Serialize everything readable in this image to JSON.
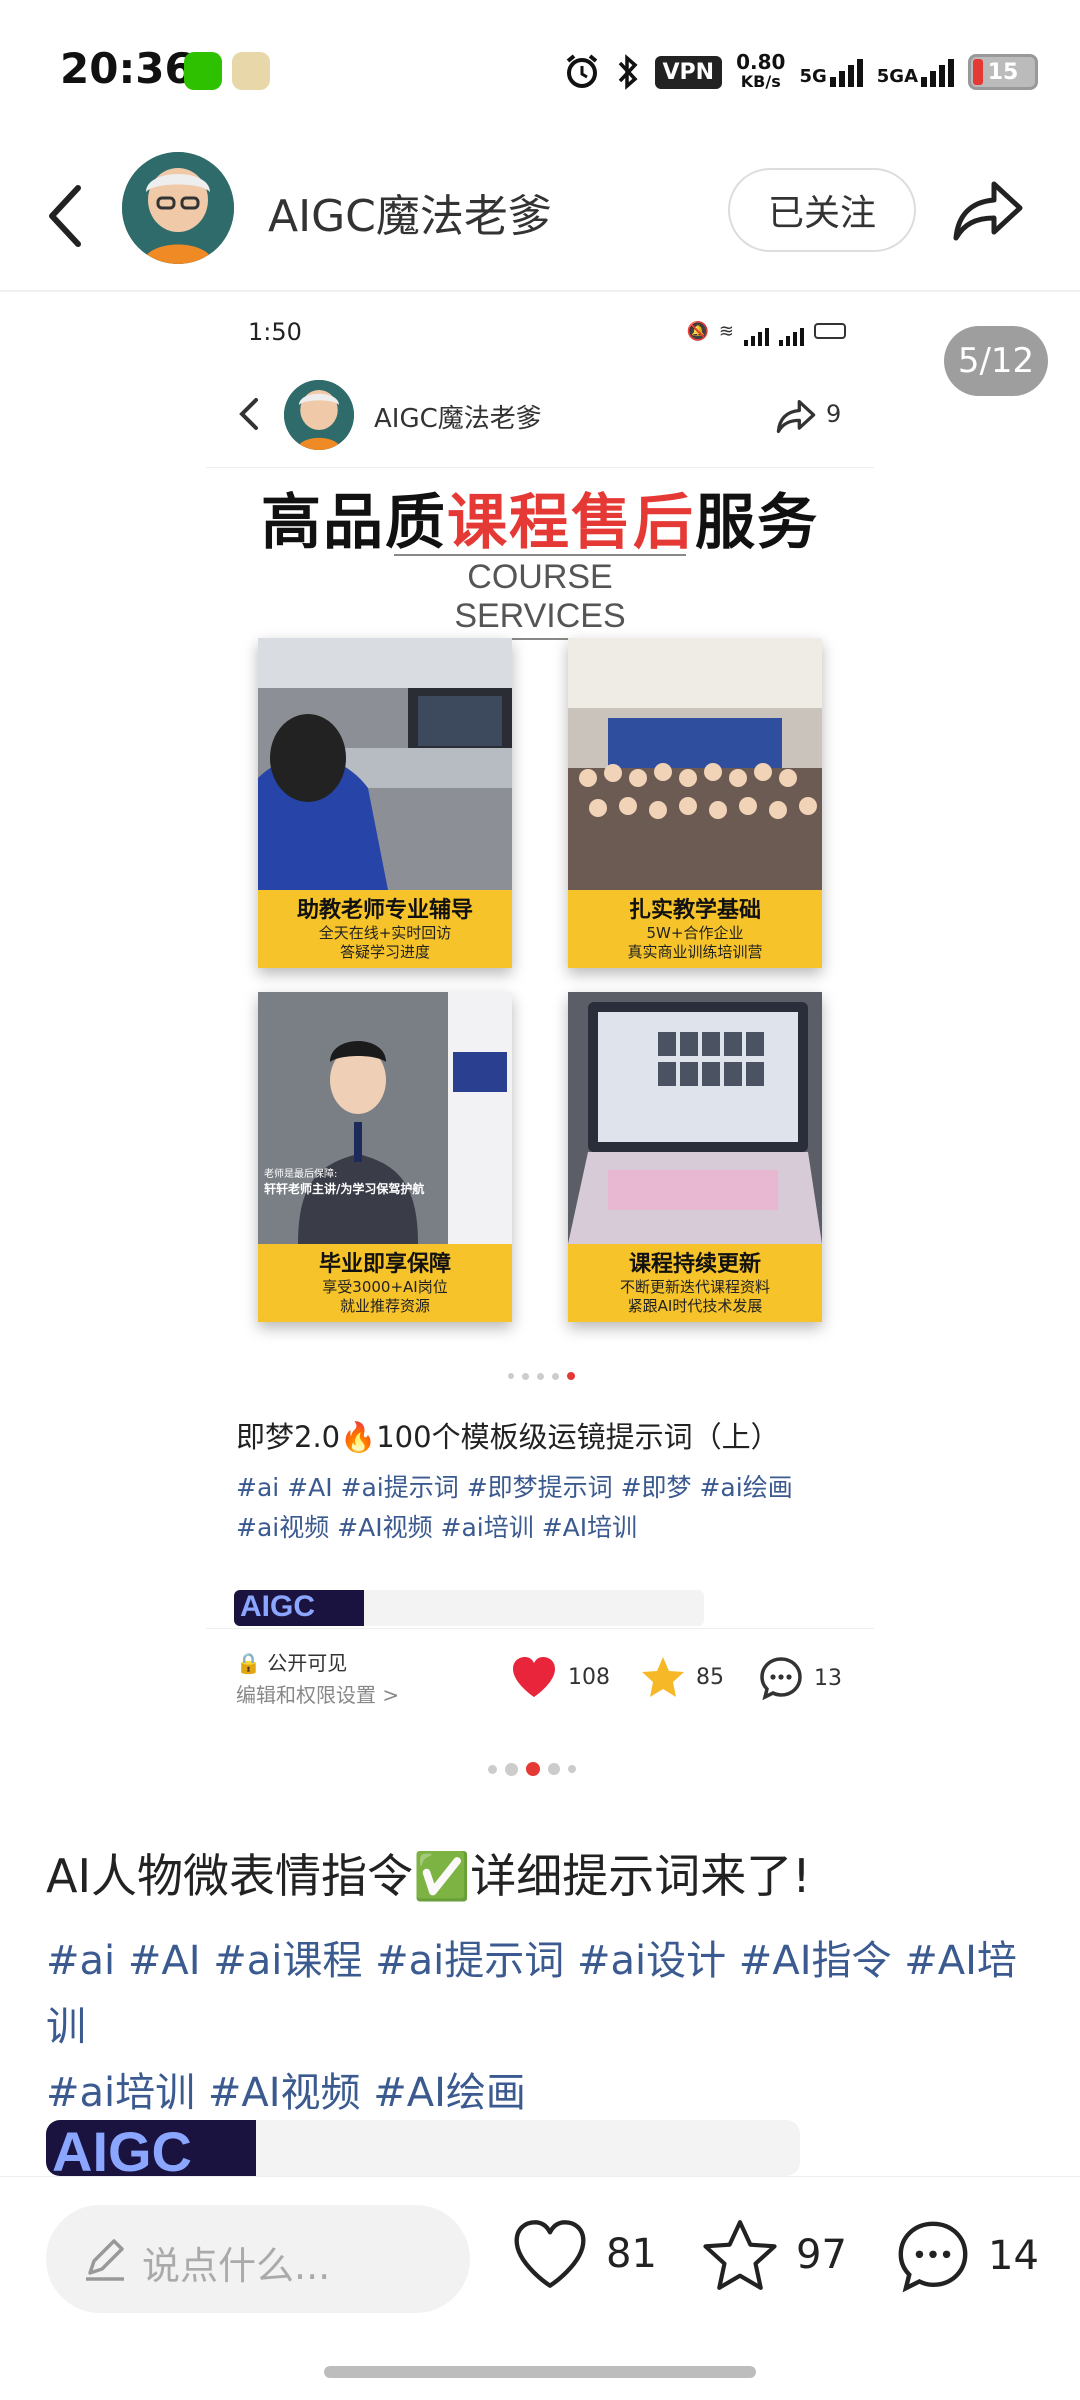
{
  "status_bar": {
    "time": "20:36",
    "vpn": "VPN",
    "speed_value": "0.80",
    "speed_unit": "KB/s",
    "net1": "5G",
    "net2": "5GA",
    "battery": "15"
  },
  "header": {
    "author": "AIGC魔法老爹",
    "follow_label": "已关注"
  },
  "pager": "5/12",
  "inner": {
    "time": "1:50",
    "author": "AIGC魔法老爹",
    "share_count": "9",
    "poster": {
      "title_a": "高品质",
      "title_red": "课程售后",
      "title_b": "服务",
      "subtitle": "COURSE SERVICES",
      "cards": [
        {
          "title": "助教老师专业辅导",
          "desc1": "全天在线+实时回访",
          "desc2": "答疑学习进度"
        },
        {
          "title": "扎实教学基础",
          "desc1": "5W+合作企业",
          "desc2": "真实商业训练培训营"
        },
        {
          "title": "毕业即享保障",
          "desc1": "享受3000+AI岗位",
          "desc2": "就业推荐资源"
        },
        {
          "title": "课程持续更新",
          "desc1": "不断更新迭代课程资料",
          "desc2": "紧跟AI时代技术发展"
        }
      ],
      "card3_overlay_1": "老师是最后保障:",
      "card3_overlay_2": "轩轩老师主讲/为学习保驾护航"
    },
    "caption": "即梦2.0🔥100个模板级运镜提示词（上）",
    "tags": "#ai #AI #ai提示词 #即梦提示词 #即梦 #ai绘画 #ai视频 #AI视频 #ai培训 #AI培训",
    "banner_logo": "AIGC",
    "public": "公开可见",
    "perm": "编辑和权限设置 >",
    "likes": "108",
    "stars": "85",
    "comments": "13"
  },
  "caption": "AI人物微表情指令✅详细提示词来了!",
  "tags_line1": "#ai #AI #ai课程 #ai提示词 #ai设计 #AI指令 #AI培训",
  "tags_line2": "#ai培训 #AI视频 #AI绘画",
  "banner_logo": "AIGC",
  "bottom": {
    "comment_placeholder": "说点什么...",
    "likes": "81",
    "stars": "97",
    "comments": "14"
  },
  "colors": {
    "accent_red": "#e53935",
    "tag_blue": "#3b5a8f",
    "card_yellow": "#f6c32a"
  }
}
